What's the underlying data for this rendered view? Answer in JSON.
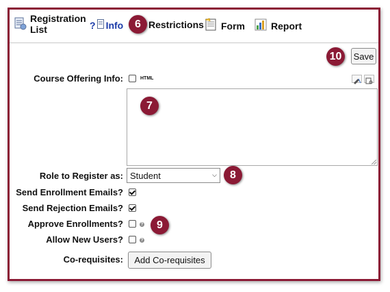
{
  "toolbar": {
    "registration_list": "Registration\nList",
    "info": "Info",
    "restrictions": "Restrictions",
    "form": "Form",
    "report": "Report"
  },
  "badges": {
    "b6": "6",
    "b7": "7",
    "b8": "8",
    "b9": "9",
    "b10": "10"
  },
  "save_label": "Save",
  "course_offering": {
    "label": "Course Offering Info:",
    "html_label": "HTML",
    "html_checked": false,
    "value": ""
  },
  "role": {
    "label": "Role to Register as:",
    "value": "Student"
  },
  "send_enrollment": {
    "label": "Send Enrollment Emails?",
    "checked": true
  },
  "send_rejection": {
    "label": "Send Rejection Emails?",
    "checked": true
  },
  "approve_enrollments": {
    "label": "Approve Enrollments?",
    "checked": false
  },
  "allow_new_users": {
    "label": "Allow New Users?",
    "checked": false
  },
  "coreq": {
    "label": "Co-requisites:",
    "button": "Add Co-requisites"
  },
  "colors": {
    "accent": "#8b1a35",
    "link": "#1a3aa8"
  }
}
